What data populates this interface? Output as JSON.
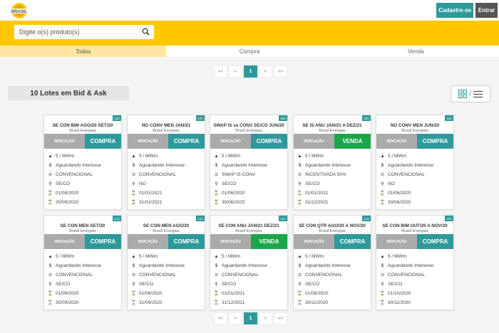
{
  "brand": {
    "logo_text": "BRASIL"
  },
  "header": {
    "signup_label": "Cadastre-se",
    "login_label": "Entrar"
  },
  "search": {
    "placeholder": "Digite o(s) produto(s)"
  },
  "tabs": [
    {
      "label": "Todos",
      "active": true
    },
    {
      "label": "Compra",
      "active": false
    },
    {
      "label": "Venda",
      "active": false
    }
  ],
  "pagination": {
    "first": "««",
    "prev": "«",
    "current": "1",
    "next": "»",
    "last": "»»"
  },
  "lots_heading": "10 Lotes em Bid & Ask",
  "view_toggle": {
    "grid_icon": "grid-icon",
    "separator": "/",
    "list_icon": "list-icon"
  },
  "indication_label": "INDICAÇÃO",
  "cards": [
    {
      "id": "122",
      "title": "SE CON BIM AGO/20 SET/20",
      "company": "Brasil Energias",
      "type": "COMPRA",
      "volume": "5 / MWm",
      "status": "Aguardando Interesse",
      "source": "CONVENCIONAL",
      "submarket": "SE/CO",
      "start": "01/08/2020",
      "end": "30/09/2020"
    },
    {
      "id": "121",
      "title": "NO CONV MEN JAN/21",
      "company": "Brasil Energias",
      "type": "COMPRA",
      "volume": "5 / MWm",
      "status": "Aguardando Interesse",
      "source": "CONVENCIONAL",
      "submarket": "NO",
      "start": "01/01/2021",
      "end": "31/01/2021"
    },
    {
      "id": "120",
      "title": "SWAP IS vs CONV SE/CO JUN/20",
      "company": "Brasil Energias",
      "type": "COMPRA",
      "volume": "5 / MWm",
      "status": "Aguardando Interesse",
      "source": "SWAP IS CONV",
      "submarket": "SE/CO",
      "start": "01/06/2020",
      "end": "30/06/2020"
    },
    {
      "id": "119",
      "title": "SE IS ANU JAN/21 A DEZ/21",
      "company": "Brasil Energias",
      "type": "VENDA",
      "volume": "5 / MWm",
      "status": "Aguardando Interesse",
      "source": "INCENTIVADA 50%",
      "submarket": "SE/CO",
      "start": "01/01/2021",
      "end": "31/12/2021"
    },
    {
      "id": "115",
      "title": "NO CONV MEN JUN/20",
      "company": "Brasil Energias",
      "type": "COMPRA",
      "volume": "5 / MWm",
      "status": "Aguardando Interesse",
      "source": "CONVENCIONAL",
      "submarket": "NO",
      "start": "01/06/2020",
      "end": "30/06/2020"
    },
    {
      "id": "113",
      "title": "SE CON MEN SET/20",
      "company": "Brasil Energias",
      "type": "COMPRA",
      "volume": "5 / MWm",
      "status": "Aguardando Interesse",
      "source": "CONVENCIONAL",
      "submarket": "SE/CO",
      "start": "01/09/2020",
      "end": "30/09/2020"
    },
    {
      "id": "112",
      "title": "SE CON MEN AGO/20",
      "company": "Brasil Energias",
      "type": "COMPRA",
      "volume": "5 / MWm",
      "status": "Aguardando Interesse",
      "source": "CONVENCIONAL",
      "submarket": "SE/CO",
      "start": "01/08/2020",
      "end": "31/08/2020"
    },
    {
      "id": "111",
      "title": "SE CON ANU JAN/21 DEZ/21",
      "company": "Brasil Energias",
      "type": "VENDA",
      "volume": "5 / MWm",
      "status": "Aguardando Interesse",
      "source": "CONVENCIONAL",
      "submarket": "SE/CO",
      "start": "01/01/2021",
      "end": "31/12/2021"
    },
    {
      "id": "110",
      "title": "SE CON QTR AGO/20 A NOV/20",
      "company": "Brasil Energias",
      "type": "COMPRA",
      "volume": "5 / MWm",
      "status": "Aguardando Interesse",
      "source": "CONVENCIONAL",
      "submarket": "SE/CO",
      "start": "01/08/2020",
      "end": "30/11/2020"
    },
    {
      "id": "101",
      "title": "SE CON BIM OUT/20 A NOV/20",
      "company": "Brasil Energias",
      "type": "COMPRA",
      "volume": "5 / MWm",
      "status": "Aguardando Interesse",
      "source": "CONVENCIONAL",
      "submarket": "SE/CO",
      "start": "01/10/2020",
      "end": "30/11/2020"
    }
  ],
  "colors": {
    "accent": "#2e999b",
    "brand_yellow": "#ffc800",
    "venda": "#1aa64a",
    "indication": "#aaaaaa"
  },
  "row_icons": [
    "bolt-icon",
    "dollar-icon",
    "source-icon",
    "location-icon",
    "start-date-icon",
    "end-date-icon"
  ]
}
